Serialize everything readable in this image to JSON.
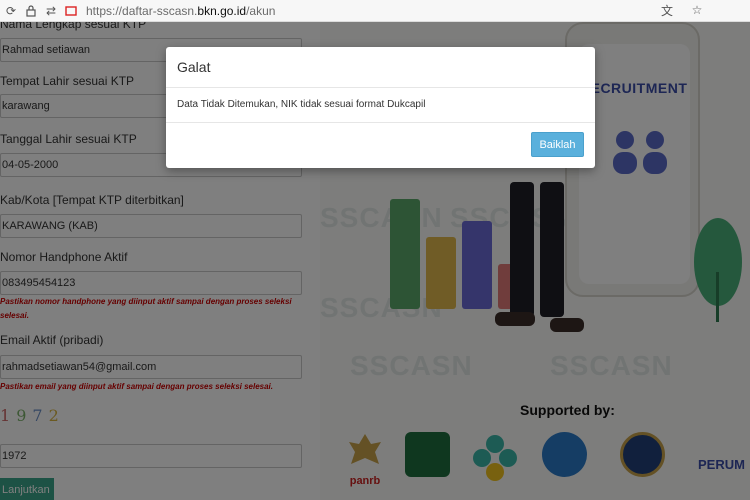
{
  "browser": {
    "url_prefix": "https://daftar-sscasn.",
    "url_domain": "bkn.go.id",
    "url_path": "/akun"
  },
  "form": {
    "label_nama": "Nama Lengkap sesuai KTP",
    "value_nama": "Rahmad setiawan",
    "label_tempat": "Tempat Lahir sesuai KTP",
    "value_tempat": "karawang",
    "label_tanggal": "Tanggal Lahir sesuai KTP",
    "value_tanggal": "04-05-2000",
    "label_kota": "Kab/Kota [Tempat KTP diterbitkan]",
    "value_kota": "KARAWANG (KAB)",
    "label_hp": "Nomor Handphone Aktif",
    "value_hp": "083495454123",
    "warn_hp": "Pastikan nomor handphone yang diinput aktif sampai dengan proses seleksi selesai.",
    "label_email": "Email Aktif (pribadi)",
    "value_email": "rahmadsetiawan54@gmail.com",
    "warn_email": "Pastikan email yang diinput aktif sampai dengan proses seleksi selesai.",
    "captcha": [
      "1",
      "9",
      "7",
      "2"
    ],
    "captcha_value": "1972",
    "next_button": "Lanjutkan"
  },
  "illustration": {
    "recruit_text": "RECRUITMENT",
    "watermark": "SSCASN",
    "supported_by": "Supported by:",
    "panrb_label": "panrb",
    "perum_label": "PERUM"
  },
  "modal": {
    "title": "Galat",
    "message": "Data Tidak Ditemukan, NIK tidak sesuai format Dukcapil",
    "ok_button": "Baiklah"
  },
  "colors": {
    "accent_button": "#5ab0dc",
    "next_button": "#3aa58a",
    "warning_text": "#cc0000"
  }
}
